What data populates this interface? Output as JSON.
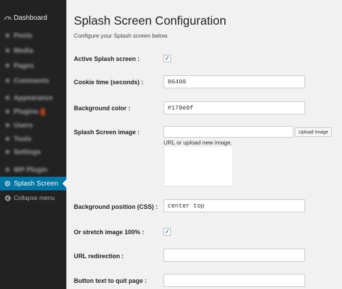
{
  "sidebar": {
    "dashboard": {
      "label": "Dashboard",
      "icon": "dashboard-icon"
    },
    "blurred_items": [
      {
        "label": "Posts",
        "icon": "pin-icon"
      },
      {
        "label": "Media",
        "icon": "media-icon"
      },
      {
        "label": "Pages",
        "icon": "page-icon"
      },
      {
        "label": "Comments",
        "icon": "comment-icon"
      },
      {
        "label": "Appearance",
        "icon": "brush-icon"
      },
      {
        "label": "Plugins",
        "icon": "plugin-icon"
      },
      {
        "label": "Users",
        "icon": "user-icon"
      },
      {
        "label": "Tools",
        "icon": "wrench-icon"
      },
      {
        "label": "Settings",
        "icon": "settings-icon"
      },
      {
        "label": "WP Plugin",
        "icon": "plugin-icon"
      }
    ],
    "active_item": {
      "label": "Splash Screen",
      "icon": "gear-icon",
      "color": "#0074a2"
    },
    "collapse": {
      "label": "Collapse menu",
      "icon": "collapse-icon"
    }
  },
  "page": {
    "title": "Splash Screen Configuration",
    "subtitle": "Configure your Splash screen below."
  },
  "form": {
    "active_label": "Active Splash screen :",
    "active_checked": true,
    "cookie_label": "Cookie time (seconds) :",
    "cookie_value": "86400",
    "bgcolor_label": "Background color :",
    "bgcolor_value": "#170e0f",
    "image_label": "Splash Screen image :",
    "image_value": "",
    "upload_button": "Upload Image",
    "image_help": "URL or upload new image.",
    "bgpos_label": "Background position (CSS) :",
    "bgpos_value": "center top",
    "stretch_label": "Or stretch image 100% :",
    "stretch_checked": true,
    "redirect_label": "URL redirection :",
    "redirect_value": "",
    "quit_label": "Button text to quit page :",
    "quit_value": ""
  },
  "colors": {
    "sidebar_bg": "#222222",
    "accent": "#0074a2",
    "page_bg": "#f1f1f1",
    "plugins_badge": "#d54e21"
  }
}
